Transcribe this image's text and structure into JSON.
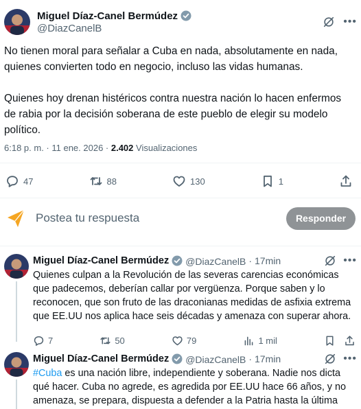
{
  "author": {
    "name": "Miguel Díaz-Canel Bermúdez",
    "handle": "@DiazCanelB"
  },
  "main_tweet": {
    "paragraph_1": "No tienen moral para señalar a Cuba en nada, absolutamente en nada, quienes convierten todo en negocio, incluso las vidas humanas.",
    "paragraph_2": "Quienes hoy drenan histéricos contra nuestra nación lo hacen enfermos de rabia por la decisión soberana de este pueblo de elegir su modelo político.",
    "timestamp": "6:18 p. m. · 11 ene. 2026 · ",
    "views_count": "2.402",
    "views_label": " Visualizaciones",
    "stats": {
      "replies": "47",
      "reposts": "88",
      "likes": "130",
      "bookmarks": "1"
    }
  },
  "reply_composer": {
    "placeholder": "Postea tu respuesta",
    "button_label": "Responder"
  },
  "replies": [
    {
      "name": "Miguel Díaz-Canel Bermúdez",
      "handle": "@DiazCanelB",
      "dot": "·",
      "time": "17min",
      "text": "Quienes culpan a la Revolución de las severas carencias económicas que padecemos, deberían callar por vergüenza. Porque saben y lo reconocen, que son fruto de las draconianas medidas de asfixia extrema que EE.UU nos aplica hace seis décadas y amenaza con superar ahora.",
      "stats": {
        "replies": "7",
        "reposts": "50",
        "likes": "79",
        "views": "1 mil"
      }
    },
    {
      "name": "Miguel Díaz-Canel Bermúdez",
      "handle": "@DiazCanelB",
      "dot": "·",
      "time": "17min",
      "hashtag": "#Cuba",
      "text": " es una nación libre, independiente y soberana. Nadie nos dicta qué hacer. Cuba no agrede, es agredida por EE.UU hace 66 años, y no amenaza, se prepara, dispuesta a defender a la Patria hasta la última gota de sangre."
    }
  ],
  "colors": {
    "text": "#0f1419",
    "secondary": "#536471",
    "accent": "#1d9bf0",
    "reply_button": "#8f9396"
  }
}
